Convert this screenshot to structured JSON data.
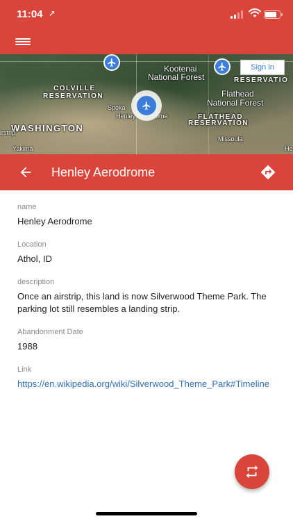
{
  "status_bar": {
    "time": "11:04",
    "location_arrow": "➚",
    "signal_bars": 4,
    "signal_bars_active": 2,
    "battery_level": 0.85
  },
  "app_bar": {
    "menu_icon": "menu-icon"
  },
  "map": {
    "labels": [
      {
        "text": "Kootenai",
        "style": "place"
      },
      {
        "text": "National Forest",
        "style": "place"
      },
      {
        "text": "COLVILLE",
        "style": "caps"
      },
      {
        "text": "RESERVATION",
        "style": "caps"
      },
      {
        "text": "Flathead",
        "style": "place"
      },
      {
        "text": "National Forest",
        "style": "place"
      },
      {
        "text": "RESERVATIO",
        "style": "caps"
      },
      {
        "text": "Spoka",
        "style": "small"
      },
      {
        "text": "Henley Aerodrome",
        "style": "small"
      },
      {
        "text": "FLATHEAD",
        "style": "caps"
      },
      {
        "text": "RESERVATION",
        "style": "caps"
      },
      {
        "text": "WASHINGTON",
        "style": "big"
      },
      {
        "text": "irstrip",
        "style": "small"
      },
      {
        "text": "Missoula",
        "style": "small"
      },
      {
        "text": "Yakima",
        "style": "small"
      },
      {
        "text": "He",
        "style": "small"
      }
    ],
    "sign_in_label": "Sign in"
  },
  "detail": {
    "title": "Henley Aerodrome",
    "fields": {
      "name_label": "name",
      "name_value": "Henley Aerodrome",
      "location_label": "Location",
      "location_value": "Athol, ID",
      "description_label": "description",
      "description_value": "Once an airstrip, this land is now Silverwood Theme Park. The parking lot still resembles a landing strip.",
      "date_label": "Abandonment Date",
      "date_value": "1988",
      "link_label": "Link",
      "link_value": "https://en.wikipedia.org/wiki/Silverwood_Theme_Park#Timeline"
    }
  },
  "colors": {
    "accent": "#d9453a",
    "link": "#2f6fb8",
    "marker": "#3b7dd8",
    "label_gray": "#8a8a8a"
  },
  "fab": {
    "icon": "swap-icon"
  }
}
